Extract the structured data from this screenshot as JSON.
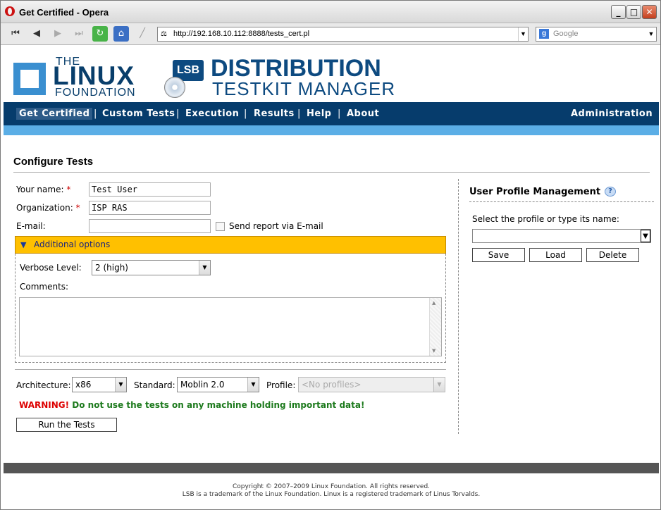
{
  "window": {
    "title": "Get Certified - Opera"
  },
  "browser": {
    "url": "http://192.168.10.112:8888/tests_cert.pl",
    "search_placeholder": "Google"
  },
  "logo": {
    "the": "THE",
    "linux": "LINUX",
    "foundation": "FOUNDATION",
    "lsb": "LSB",
    "dist_title": "DISTRIBUTION",
    "dist_sub": "TESTKIT MANAGER"
  },
  "nav": {
    "items": [
      "Get Certified",
      "Custom Tests",
      "Execution",
      "Results",
      "Help",
      "About"
    ],
    "admin": "Administration",
    "separator": "|"
  },
  "configure": {
    "title": "Configure Tests",
    "name_label": "Your name:",
    "name_value": "Test User",
    "org_label": "Organization:",
    "org_value": "ISP RAS",
    "email_label": "E-mail:",
    "email_value": "",
    "send_report_label": "Send report via E-mail",
    "required_mark": "*",
    "additional_options": "Additional options",
    "verbose_label": "Verbose Level:",
    "verbose_value": "2 (high)",
    "comments_label": "Comments:",
    "arch_label": "Architecture:",
    "arch_value": "x86",
    "standard_label": "Standard:",
    "standard_value": "Moblin 2.0",
    "profile_label": "Profile:",
    "profile_value": "<No profiles>",
    "warning_prefix": "WARNING!",
    "warning_text": "Do not use the tests on any machine holding important data!",
    "run_button": "Run the Tests"
  },
  "profile": {
    "title": "User Profile Management",
    "select_label": "Select the profile or type its name:",
    "save": "Save",
    "load": "Load",
    "delete": "Delete"
  },
  "footer": {
    "copyright": "Copyright © 2007–2009 Linux Foundation. All rights reserved.",
    "trademark": "LSB is a trademark of the Linux Foundation. Linux is a registered trademark of Linus Torvalds."
  },
  "colors": {
    "nav_bg": "#063c6c",
    "nav_stripe": "#5baee6",
    "options_bar": "#ffc000",
    "warning_red": "#dd0000",
    "warning_green": "#1d7a1d"
  }
}
